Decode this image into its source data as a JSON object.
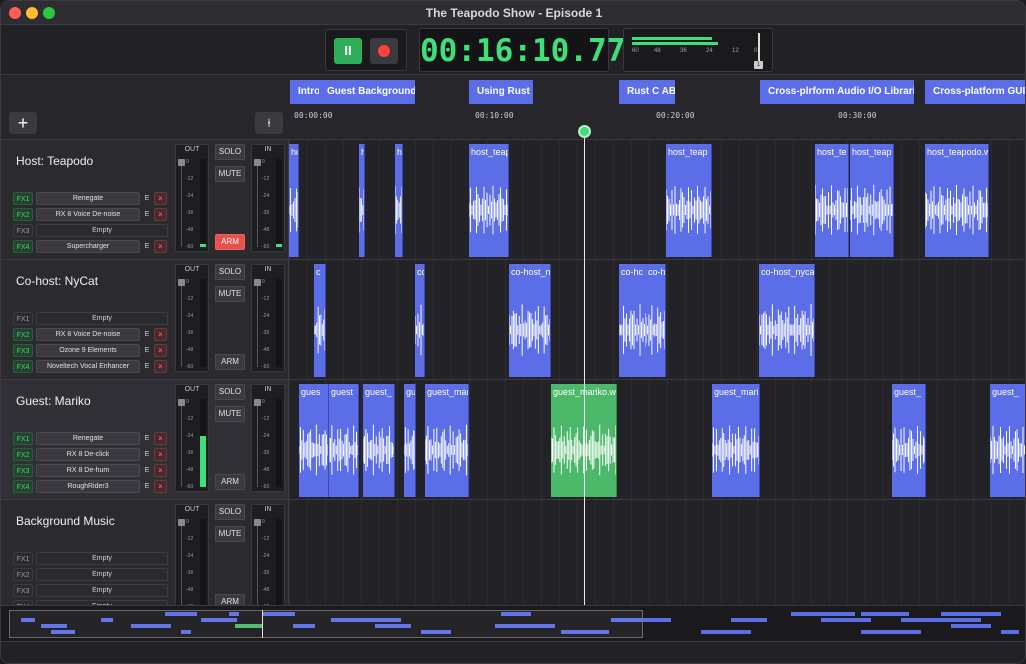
{
  "window": {
    "title": "The Teapodo Show - Episode 1"
  },
  "transport": {
    "pause_label": "II",
    "timecode": "00:16:10.770",
    "meter_scale": [
      "60",
      "48",
      "36",
      "24",
      "12",
      "0"
    ],
    "meter_knob_label": "1"
  },
  "toolbar": {
    "add_label": "+",
    "split_label": "⍿"
  },
  "chapters": [
    {
      "label": "Intro"
    },
    {
      "label": "Guest Background"
    },
    {
      "label": "Using Rust"
    },
    {
      "label": "Rust C ABI"
    },
    {
      "label": "Cross-plrform Audio I/O Libraries"
    },
    {
      "label": "Cross-platform GUI Li"
    }
  ],
  "ruler": [
    "00:00:00",
    "00:10:00",
    "00:20:00",
    "00:30:00"
  ],
  "meter_scale": [
    "0",
    "-12",
    "-24",
    "-36",
    "-48",
    "-60"
  ],
  "tracks": [
    {
      "name": "Host: Teapodo",
      "out_label": "OUT",
      "in_label": "IN",
      "solo": "SOLO",
      "mute": "MUTE",
      "arm": "ARM",
      "armed": true,
      "out_level": 0.03,
      "in_level": 0.03,
      "fx": [
        {
          "tag": "FX1",
          "plugin": "Renegate",
          "on": true,
          "e": "E",
          "x": "×"
        },
        {
          "tag": "FX2",
          "plugin": "RX 8 Voice De-noise",
          "on": true,
          "e": "E",
          "x": "×"
        },
        {
          "tag": "FX3",
          "plugin": "Empty",
          "on": false
        },
        {
          "tag": "FX4",
          "plugin": "Supercharger",
          "on": true,
          "e": "E",
          "x": "×"
        }
      ],
      "clips": [
        {
          "label": "ho"
        },
        {
          "label": "h"
        },
        {
          "label": "hc"
        },
        {
          "label": "host_teap"
        },
        {
          "label": "host_teap"
        },
        {
          "label": "host_te"
        },
        {
          "label": "host_teap"
        },
        {
          "label": "host_teapodo.w"
        }
      ]
    },
    {
      "name": "Co-host: NyCat",
      "out_label": "OUT",
      "in_label": "IN",
      "solo": "SOLO",
      "mute": "MUTE",
      "arm": "ARM",
      "armed": false,
      "out_level": 0,
      "in_level": 0,
      "fx": [
        {
          "tag": "FX1",
          "plugin": "Empty",
          "on": false
        },
        {
          "tag": "FX2",
          "plugin": "RX 8 Voice De-noise",
          "on": true,
          "e": "E",
          "x": "×"
        },
        {
          "tag": "FX3",
          "plugin": "Ozone 9 Elements",
          "on": true,
          "e": "E",
          "x": "×"
        },
        {
          "tag": "FX4",
          "plugin": "Noveltech Vocal Enhancer",
          "on": true,
          "e": "E",
          "x": "×"
        }
      ],
      "clips": [
        {
          "label": "c"
        },
        {
          "label": "co"
        },
        {
          "label": "co-host_n"
        },
        {
          "label": "co-hc"
        },
        {
          "label": "co-h"
        },
        {
          "label": "co-host_nyca"
        }
      ]
    },
    {
      "name": "Guest: Mariko",
      "out_label": "OUT",
      "in_label": "IN",
      "solo": "SOLO",
      "mute": "MUTE",
      "arm": "ARM",
      "armed": false,
      "out_level": 0.58,
      "in_level": 0,
      "fx": [
        {
          "tag": "FX1",
          "plugin": "Renegate",
          "on": true,
          "e": "E",
          "x": "×"
        },
        {
          "tag": "FX2",
          "plugin": "RX 8 De-click",
          "on": true,
          "e": "E",
          "x": "×"
        },
        {
          "tag": "FX3",
          "plugin": "RX 8 De-hum",
          "on": true,
          "e": "E",
          "x": "×"
        },
        {
          "tag": "FX4",
          "plugin": "RoughRider3",
          "on": true,
          "e": "E",
          "x": "×"
        }
      ],
      "clips": [
        {
          "label": "gues"
        },
        {
          "label": "guest"
        },
        {
          "label": "guest_"
        },
        {
          "label": "gu"
        },
        {
          "label": "guest_mari"
        },
        {
          "label": "guest_mariko.wa"
        },
        {
          "label": "guest_mari"
        },
        {
          "label": "guest_"
        },
        {
          "label": "guest_"
        }
      ]
    },
    {
      "name": "Background Music",
      "out_label": "OUT",
      "in_label": "IN",
      "solo": "SOLO",
      "mute": "MUTE",
      "arm": "ARM",
      "armed": false,
      "out_level": 0,
      "in_level": 0,
      "fx": [
        {
          "tag": "FX1",
          "plugin": "Empty",
          "on": false
        },
        {
          "tag": "FX2",
          "plugin": "Empty",
          "on": false
        },
        {
          "tag": "FX3",
          "plugin": "Empty",
          "on": false
        },
        {
          "tag": "FX4",
          "plugin": "Empty",
          "on": false
        }
      ],
      "clips": []
    }
  ],
  "colors": {
    "clip": "#5b6ee8",
    "clip_selected": "#4cb86a",
    "meter": "#3ee07a",
    "arm": "#e85050"
  }
}
